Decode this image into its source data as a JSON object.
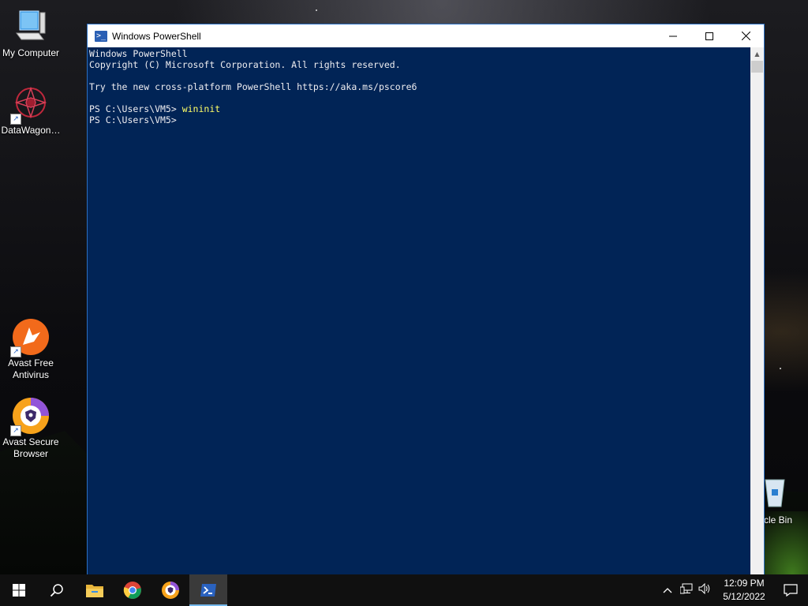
{
  "desktop": {
    "icons": [
      {
        "label": "My Computer",
        "icon": "computer-icon"
      },
      {
        "label": "DataWagon…",
        "icon": "datawagon-icon"
      },
      {
        "label": "Avast Free Antivirus",
        "icon": "avast-antivirus-icon"
      },
      {
        "label": "Avast Secure Browser",
        "icon": "avast-browser-icon"
      },
      {
        "label": "cle Bin",
        "icon": "recycle-bin-icon"
      }
    ]
  },
  "window": {
    "title": "Windows PowerShell",
    "icon": "powershell-icon",
    "controls": {
      "minimize": "—",
      "maximize": "☐",
      "close": "✕"
    }
  },
  "console": {
    "lines": [
      "Windows PowerShell",
      "Copyright (C) Microsoft Corporation. All rights reserved.",
      "",
      "Try the new cross-platform PowerShell https://aka.ms/pscore6",
      ""
    ],
    "prompt1": "PS C:\\Users\\VM5> ",
    "command1": "wininit",
    "prompt2": "PS C:\\Users\\VM5> ",
    "colors": {
      "background": "#012456",
      "text": "#eeedf0",
      "command": "#ffff66"
    }
  },
  "taskbar": {
    "items": [
      "start-icon",
      "search-icon",
      "file-explorer-icon",
      "chrome-icon",
      "avast-browser-icon",
      "powershell-icon"
    ],
    "active": "powershell-icon",
    "tray": {
      "time": "12:09 PM",
      "date": "5/12/2022",
      "icons": [
        "chevron-up-icon",
        "network-icon",
        "volume-icon"
      ]
    }
  }
}
